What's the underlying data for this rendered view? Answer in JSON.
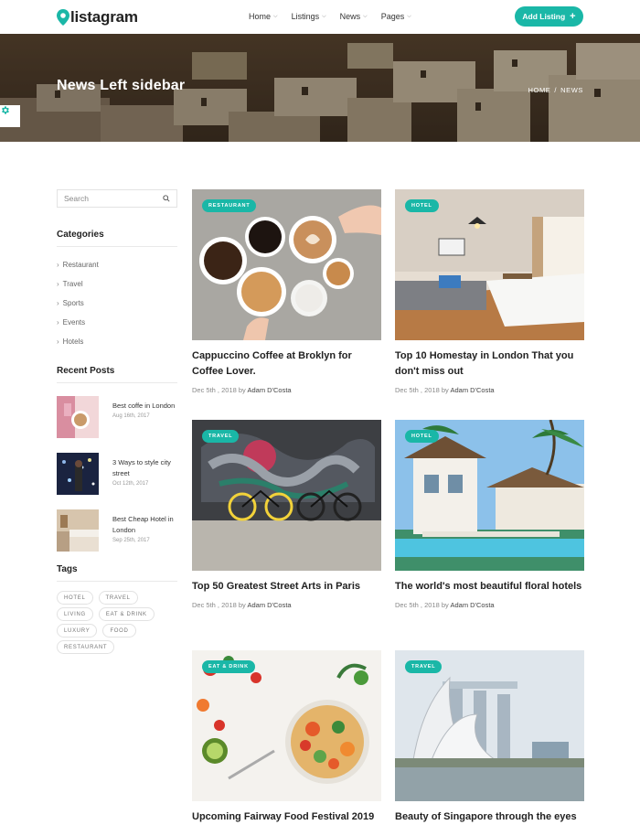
{
  "brand": {
    "name": "listagram",
    "accent": "#1ab7a7"
  },
  "nav": [
    {
      "label": "Home"
    },
    {
      "label": "Listings"
    },
    {
      "label": "News"
    },
    {
      "label": "Pages"
    }
  ],
  "header": {
    "add_listing_label": "Add Listing",
    "add_icon": "plus-icon"
  },
  "hero": {
    "title": "News Left sidebar",
    "breadcrumb": [
      "HOME",
      "NEWS"
    ],
    "breadcrumb_separator": "/"
  },
  "sidebar": {
    "search_placeholder": "Search",
    "categories_title": "Categories",
    "categories": [
      "Restaurant",
      "Travel",
      "Sports",
      "Events",
      "Hotels"
    ],
    "recent_title": "Recent Posts",
    "recent_posts": [
      {
        "title": "Best coffe in London",
        "date": "Aug 16th, 2017"
      },
      {
        "title": "3 Ways to style city street",
        "date": "Oct 12th, 2017"
      },
      {
        "title": "Best Cheap Hotel in London",
        "date": "Sep 25th, 2017"
      }
    ],
    "tags_title": "Tags",
    "tags": [
      "HOTEL",
      "TRAVEL",
      "LIVING",
      "EAT & DRINK",
      "LUXURY",
      "FOOD",
      "RESTAURANT"
    ]
  },
  "posts": [
    {
      "category": "RESTAURANT",
      "title": "Cappuccino Coffee at Broklyn for Coffee Lover.",
      "date": "Dec 5th , 2018",
      "by": "by",
      "author": "Adam D'Costa"
    },
    {
      "category": "HOTEL",
      "title": "Top 10 Homestay in London That you don't miss out",
      "date": "Dec 5th , 2018",
      "by": "by",
      "author": "Adam D'Costa"
    },
    {
      "category": "TRAVEL",
      "title": "Top 50 Greatest Street Arts in Paris",
      "date": "Dec 5th , 2018",
      "by": "by",
      "author": "Adam D'Costa"
    },
    {
      "category": "HOTEL",
      "title": "The world's most beautiful floral hotels",
      "date": "Dec 5th , 2018",
      "by": "by",
      "author": "Adam D'Costa"
    },
    {
      "category": "EAT & DRINK",
      "title": "Upcoming Fairway Food Festival 2019",
      "date": "",
      "by": "",
      "author": ""
    },
    {
      "category": "TRAVEL",
      "title": "Beauty of Singapore through the eyes",
      "date": "",
      "by": "",
      "author": ""
    }
  ]
}
